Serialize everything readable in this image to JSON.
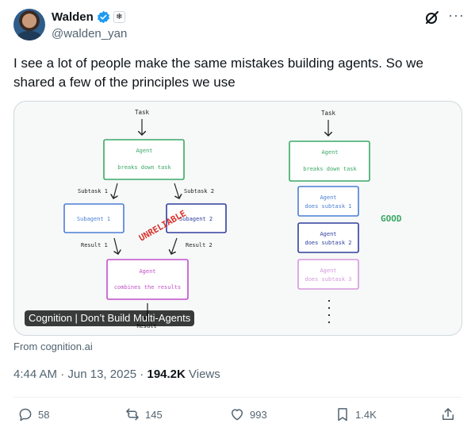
{
  "author": {
    "name": "Walden",
    "handle": "@walden_yan",
    "affiliate_glyph": "❄"
  },
  "tweet": {
    "text": "I see a lot of people make the same mistakes building agents. So we shared a few of the principles we use"
  },
  "card": {
    "label": "Cognition | Don’t Build Multi-Agents",
    "left_diagram": {
      "task": "Task",
      "agent_title": "Agent",
      "agent_sub": "breaks down task",
      "subtask1": "Subtask 1",
      "subtask2": "Subtask 2",
      "subagent1": "Subagent 1",
      "subagent2": "Subagent 2",
      "warning": "UNRELIABLE",
      "result1": "Result 1",
      "result2": "Result 2",
      "combine_title": "Agent",
      "combine_sub": "combines the results",
      "result": "Result"
    },
    "right_diagram": {
      "task": "Task",
      "agent_title": "Agent",
      "agent_sub": "breaks down task",
      "step1_title": "Agent",
      "step1_sub": "does subtask 1",
      "step2_title": "Agent",
      "step2_sub": "does subtask 2",
      "step3_title": "Agent",
      "step3_sub": "does subtask 3",
      "verdict": "GOOD"
    }
  },
  "source": "From cognition.ai",
  "meta": {
    "time": "4:44 AM",
    "sep": " · ",
    "date": "Jun 13, 2025",
    "views_count": "194.2K",
    "views_label": " Views"
  },
  "actions": {
    "replies": "58",
    "reposts": "145",
    "likes": "993",
    "bookmarks": "1.4K"
  },
  "colors": {
    "green": "#3aa866",
    "blue": "#4a7fd6",
    "navy": "#2f3f9e",
    "purple": "#c04fc9",
    "red": "#d8322a",
    "verified": "#1d9bf0"
  }
}
